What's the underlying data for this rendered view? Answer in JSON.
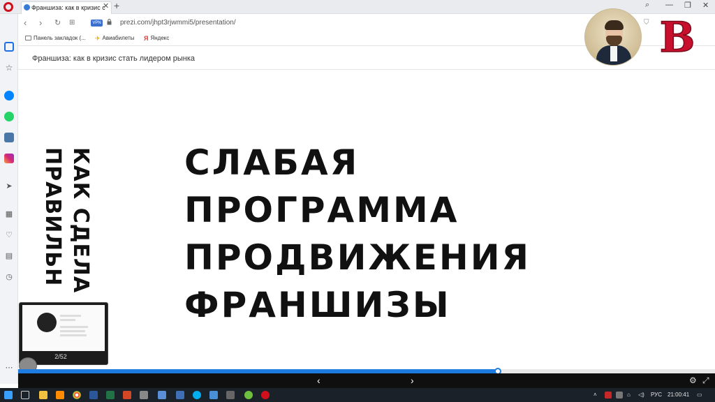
{
  "browser": {
    "tab_title": "Франшиза: как в кризис с",
    "url": "prezi.com/jhpt3rjwmmi5/presentation/",
    "vpn_label": "VPN",
    "bookmarks": [
      "Панель закладок (...",
      "Авиабилеты",
      "Яндекс"
    ],
    "colors": {
      "brand": "#d0101b",
      "vpn": "#3a6fd0"
    }
  },
  "sidebar": {
    "icons": [
      "home-icon",
      "bookmark-star-icon",
      "messenger-icon",
      "whatsapp-icon",
      "vk-icon",
      "instagram-icon",
      "send-icon",
      "apps-grid-icon",
      "heart-icon",
      "news-icon",
      "history-icon",
      "more-icon"
    ]
  },
  "presentation": {
    "header_title": "Франшиза: как в кризис стать лидером рынка",
    "vertical_text": [
      "КАК СДЕЛА",
      "ПРАВИЛЬН"
    ],
    "headline_lines": [
      "СЛАБАЯ",
      "ПРОГРАММА",
      "ПРОДВИЖЕНИЯ",
      "ФРАНШИЗЫ"
    ],
    "slide_counter": "2/52",
    "progress": 0.688,
    "colors": {
      "accent": "#1e7be0",
      "text": "#111111"
    }
  },
  "logo": {
    "letter": "B",
    "color": "#c8102e"
  },
  "taskbar": {
    "language": "РУС",
    "time": "21:00:41"
  }
}
